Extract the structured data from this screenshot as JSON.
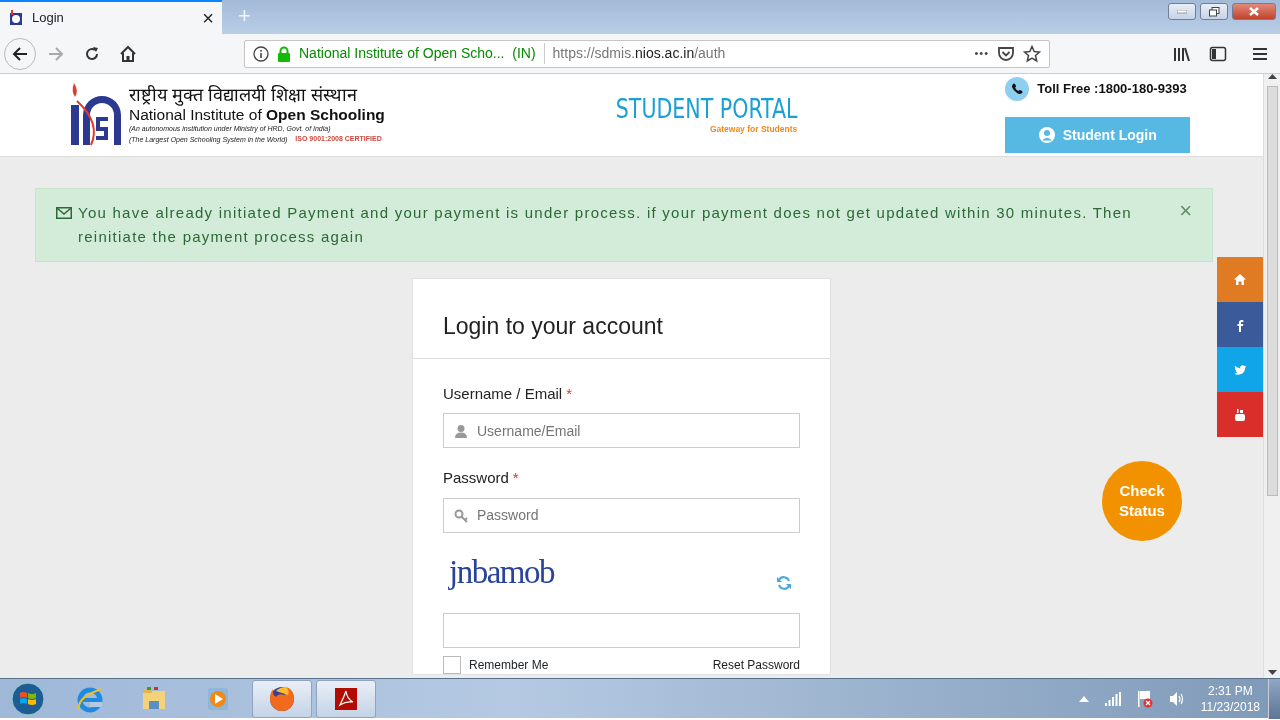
{
  "browser": {
    "tab": {
      "title": "Login",
      "close": "×"
    },
    "new_tab": "+",
    "identity": "National Institute of Open Scho...  (IN)",
    "url": {
      "prefix": "https://sdmis.",
      "domain": "nios.ac.in",
      "path": "/auth"
    },
    "more": "•••"
  },
  "header": {
    "hindi_name": "राष्ट्रीय मुक्त विद्यालयी शिक्षा संस्थान",
    "english_name": "National Institute of **Open Schooling**",
    "taglines": [
      "(An autonomous institution under Ministry of HRD, Govt. of India)",
      "(The Largest Open Schooling System in the World)"
    ],
    "iso": "ISO 9001:2008 CERTIFIED",
    "portal_title": "STUDENT PORTAL",
    "portal_subtitle": "Gateway for Students",
    "toll_free": "Toll Free :1800-180-9393",
    "login_button": "Student Login"
  },
  "alert": {
    "text": "You have already initiated Payment and your payment is under process. if your payment does not get updated within 30 minutes. Then reinitiate the payment process again",
    "close": "×"
  },
  "login": {
    "title": "Login to your account",
    "fields": [
      {
        "label": "Username / Email",
        "required": true,
        "placeholder": "Username/Email",
        "kind": "user"
      },
      {
        "label": "Password",
        "required": true,
        "placeholder": "Password",
        "kind": "key"
      }
    ],
    "required_mark": "*",
    "captcha": "jnbamob",
    "remember": {
      "label": "Remember Me",
      "checked": false
    },
    "reset": "Reset Password"
  },
  "social": [
    {
      "kind": "home"
    },
    {
      "kind": "facebook"
    },
    {
      "kind": "twitter"
    },
    {
      "kind": "youtube"
    }
  ],
  "check_status": "Check Status",
  "taskbar": {
    "apps": [
      {
        "kind": "ie",
        "running": false
      },
      {
        "kind": "explorer",
        "running": false
      },
      {
        "kind": "media",
        "running": false
      },
      {
        "kind": "firefox",
        "running": true
      },
      {
        "kind": "acrobat",
        "running": true
      }
    ],
    "time": "2:31 PM",
    "date": "11/23/2018"
  }
}
